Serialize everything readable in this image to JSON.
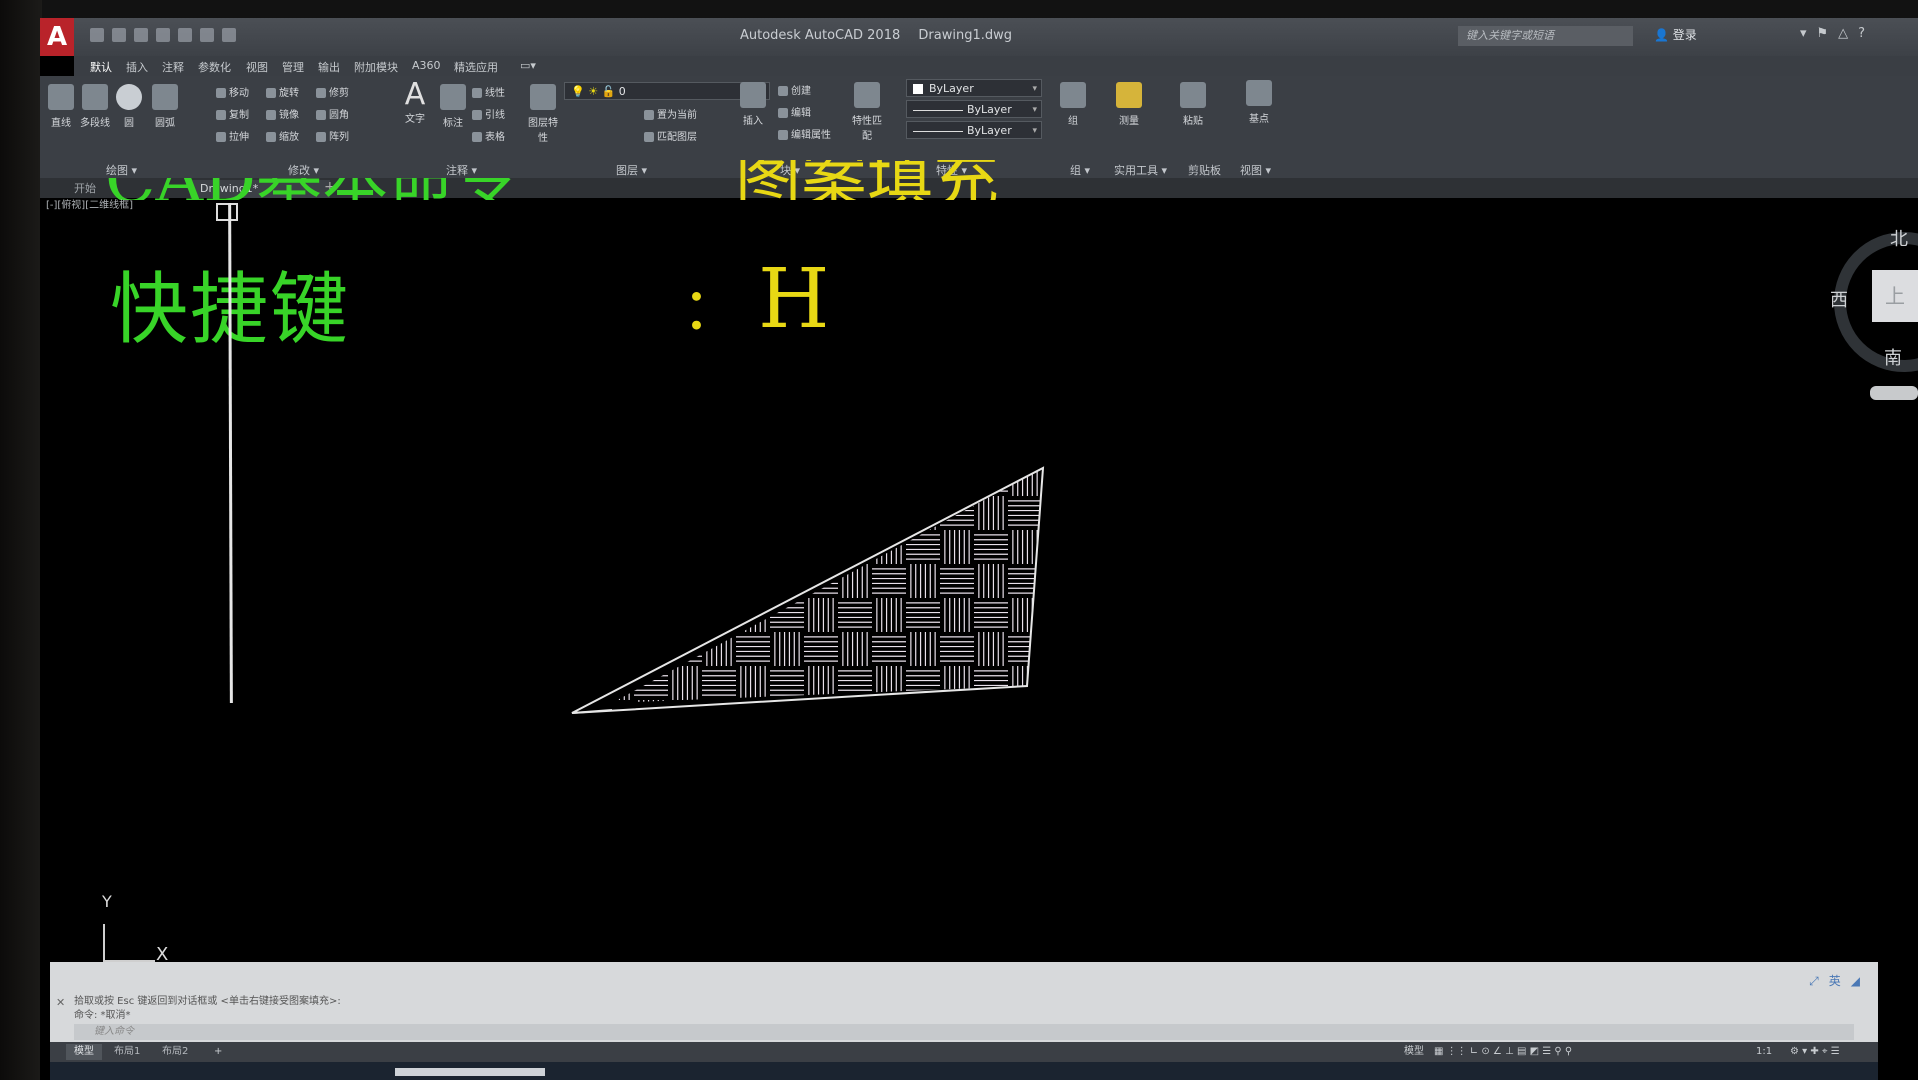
{
  "app": {
    "logo": "A",
    "title": "Autodesk AutoCAD 2018",
    "filename": "Drawing1.dwg",
    "search_placeholder": "键入关键字或短语",
    "login": "登录"
  },
  "menu_tabs": [
    "默认",
    "插入",
    "注释",
    "参数化",
    "视图",
    "管理",
    "输出",
    "附加模块",
    "A360",
    "精选应用"
  ],
  "ribbon": {
    "draw_buttons": [
      "直线",
      "多段线",
      "圆",
      "圆弧"
    ],
    "modify": [
      "移动",
      "旋转",
      "修剪",
      "复制",
      "镜像",
      "圆角",
      "拉伸",
      "缩放",
      "阵列"
    ],
    "annotation": [
      "文字",
      "标注",
      "线性",
      "引线",
      "表格"
    ],
    "layer_props": "图层特性",
    "layer_value": "0",
    "layer_buttons": [
      "置为当前",
      "匹配图层"
    ],
    "block": [
      "插入",
      "创建",
      "编辑",
      "编辑属性"
    ],
    "properties": {
      "match": "特性匹配",
      "color": "ByLayer",
      "linetype": "ByLayer",
      "lineweight": "ByLayer"
    },
    "group": "组",
    "utilities": "测量",
    "clipboard": "粘贴",
    "view": "基点",
    "panels": [
      "绘图 ▾",
      "修改 ▾",
      "注释 ▾",
      "图层 ▾",
      "块 ▾",
      "特性 ▾",
      "组 ▾",
      "实用工具 ▾",
      "剪贴板",
      "视图 ▾"
    ]
  },
  "file_tabs": [
    "开始",
    "Drawing1*"
  ],
  "viewport_label": "[-][俯视][二维线框]",
  "canvas": {
    "heading_top_green": "CAD基本命令",
    "heading_top_yellow": "图案填充",
    "shortcut_label": "快捷键",
    "colon": "：",
    "shortcut_key": "H"
  },
  "viewcube": {
    "north": "北",
    "west": "西",
    "south": "南",
    "face": "上"
  },
  "ucs": {
    "x": "X",
    "y": "Y"
  },
  "command": {
    "history_1": "拾取或按 Esc 键返回到对话框或 <单击右键接受图案填充>:",
    "history_2": "命令: *取消*",
    "input_placeholder": "键入命令"
  },
  "layout_tabs": [
    "模型",
    "布局1",
    "布局2"
  ],
  "status": {
    "model": "模型",
    "scale": "1:1"
  },
  "colors": {
    "green_text": "#38d428",
    "yellow_text": "#e8d814",
    "background": "#000000"
  }
}
